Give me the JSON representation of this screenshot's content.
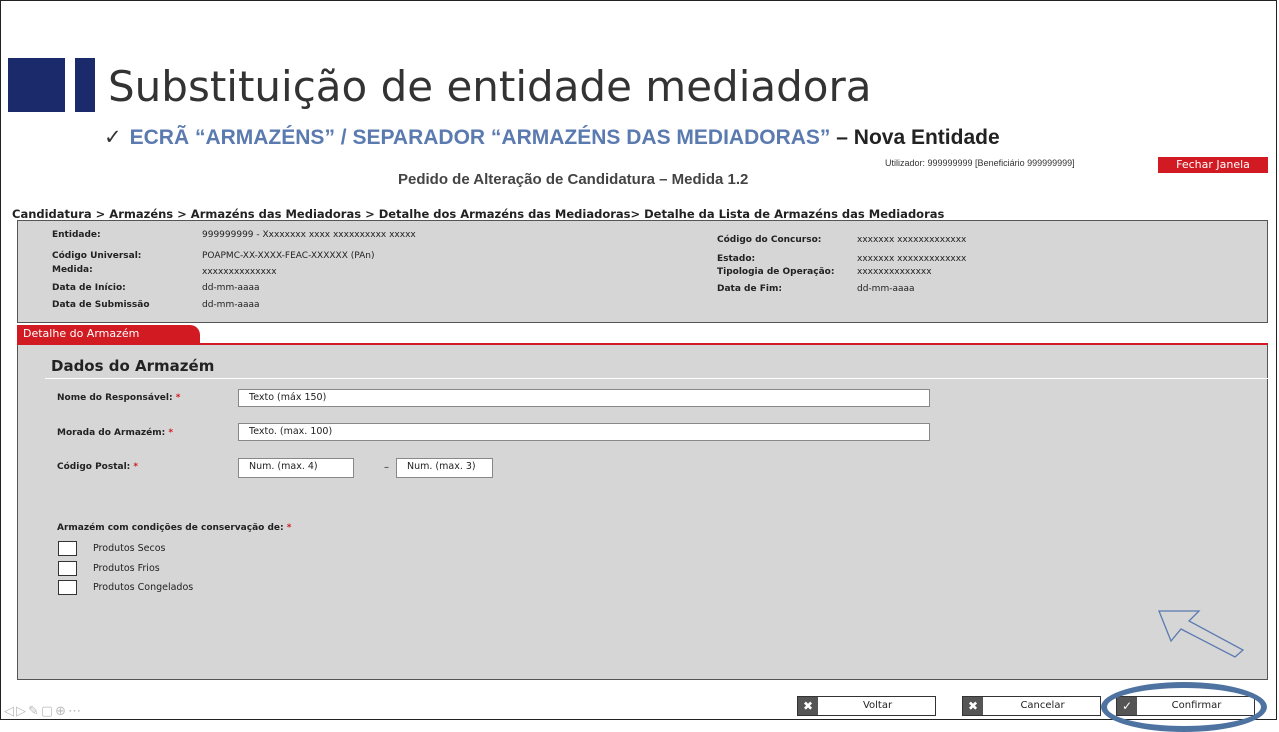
{
  "slide": {
    "title": "Substituição de entidade mediadora",
    "subtitle_blue": "ECRÃ “ARMAZÉNS” / SEPARADOR “ARMAZÉNS DAS MEDIADORAS”",
    "subtitle_black": "– Nova Entidade",
    "check_icon": "✓"
  },
  "header": {
    "user": "Utilizador: 999999999 [Beneficiário 999999999]",
    "close_label": "Fechar Janela",
    "page_title": "Pedido de Alteração de Candidatura – Medida 1.2",
    "breadcrumb": "Candidatura > Armazéns > Armazéns das Mediadoras > Detalhe dos Armazéns das Mediadoras> Detalhe da Lista de Armazéns das Mediadoras"
  },
  "info": {
    "entidade_label": "Entidade:",
    "entidade_value": "999999999 - Xxxxxxxx xxxx xxxxxxxxxx xxxxx",
    "codigo_universal_label": "Código Universal:",
    "codigo_universal_value": "POAPMC-XX-XXXX-FEAC-XXXXXX (PAn)",
    "medida_label": "Medida:",
    "medida_value": "xxxxxxxxxxxxxx",
    "data_inicio_label": "Data de Início:",
    "data_inicio_value": "dd-mm-aaaa",
    "data_submissao_label": "Data de Submissão",
    "data_submissao_value": "dd-mm-aaaa",
    "codigo_concurso_label": "Código do Concurso:",
    "codigo_concurso_value": "xxxxxxx xxxxxxxxxxxxx",
    "estado_label": "Estado:",
    "estado_value": "xxxxxxx xxxxxxxxxxxxx",
    "tipologia_label": "Tipologia de Operação:",
    "tipologia_value": "xxxxxxxxxxxxxx",
    "data_fim_label": "Data de Fim:",
    "data_fim_value": "dd-mm-aaaa"
  },
  "form": {
    "tab_label": "Detalhe do Armazém",
    "section_title": "Dados do Armazém",
    "required_mark": "*",
    "nome_label": "Nome do Responsável:",
    "nome_value": "Texto (máx 150)",
    "morada_label": "Morada do Armazém:",
    "morada_value": "Texto. (max. 100)",
    "codigo_postal_label": "Código Postal:",
    "cp1_value": "Num. (max. 4)",
    "cp_separator": "–",
    "cp2_value": "Num. (max. 3)",
    "conservacao_label": "Armazém com condições de conservação de:",
    "options": [
      "Produtos Secos",
      "Produtos Frios",
      "Produtos Congelados"
    ]
  },
  "buttons": {
    "voltar": "Voltar",
    "cancelar": "Cancelar",
    "confirmar": "Confirmar",
    "x_icon": "✖",
    "check_icon": "✓"
  }
}
